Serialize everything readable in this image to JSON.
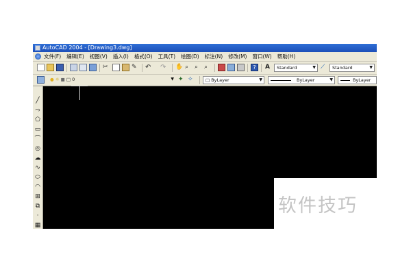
{
  "window": {
    "title": "AutoCAD 2004 - [Drawing3.dwg]"
  },
  "menu": [
    "文件(F)",
    "编辑(E)",
    "视图(V)",
    "插入(I)",
    "格式(O)",
    "工具(T)",
    "绘图(D)",
    "标注(N)",
    "修改(M)",
    "窗口(W)",
    "帮助(H)"
  ],
  "toolbar": {
    "text_style": "Standard",
    "dim_style": "Standard"
  },
  "properties": {
    "layer": "0",
    "color": "ByLayer",
    "linetype": "ByLayer",
    "lineweight": "ByLayer"
  },
  "watermark": "软件技巧",
  "colors": {
    "canvas": "#000000",
    "chrome": "#ece9d8",
    "titlebar": "#1d4fb8"
  }
}
